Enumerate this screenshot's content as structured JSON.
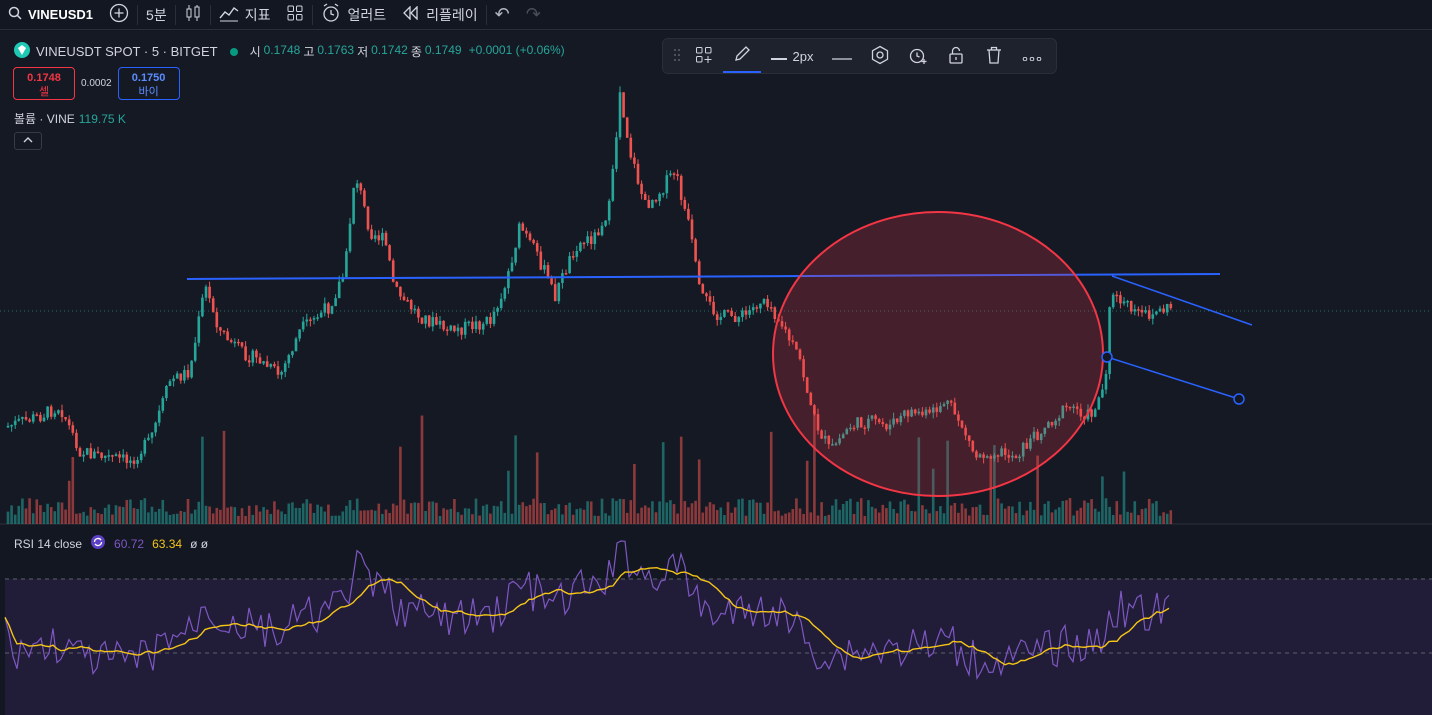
{
  "topbar": {
    "symbol": "VINEUSD1",
    "add_label": "+",
    "interval": "5분",
    "indicators": "지표",
    "alert": "얼러트",
    "replay": "리플레이",
    "undo": "↶",
    "redo": "↷"
  },
  "legend": {
    "title": "VINEUSDT SPOT · 5 · BITGET",
    "open_label": "시",
    "open": "0.1748",
    "high_label": "고",
    "high": "0.1763",
    "low_label": "저",
    "low": "0.1742",
    "close_label": "종",
    "close": "0.1749",
    "change": "+0.0001 (+0.06%)"
  },
  "trade": {
    "sell_price": "0.1748",
    "sell_label": "셀",
    "spread": "0.0002",
    "buy_price": "0.1750",
    "buy_label": "바이"
  },
  "volume": {
    "label": "볼륨 · VINE",
    "value": "119.75 K"
  },
  "drawtoolbar": {
    "width_label": "2px"
  },
  "rsi": {
    "label": "RSI 14 close",
    "value1": "60.72",
    "value2": "63.34",
    "extra": "ø ø"
  },
  "colors": {
    "up": "#26a69a",
    "down": "#ef5350",
    "trend": "#2962ff",
    "ellipse_stroke": "#f23645",
    "rsi": "#7e57c2",
    "rsi_ma": "#f5c518"
  }
}
